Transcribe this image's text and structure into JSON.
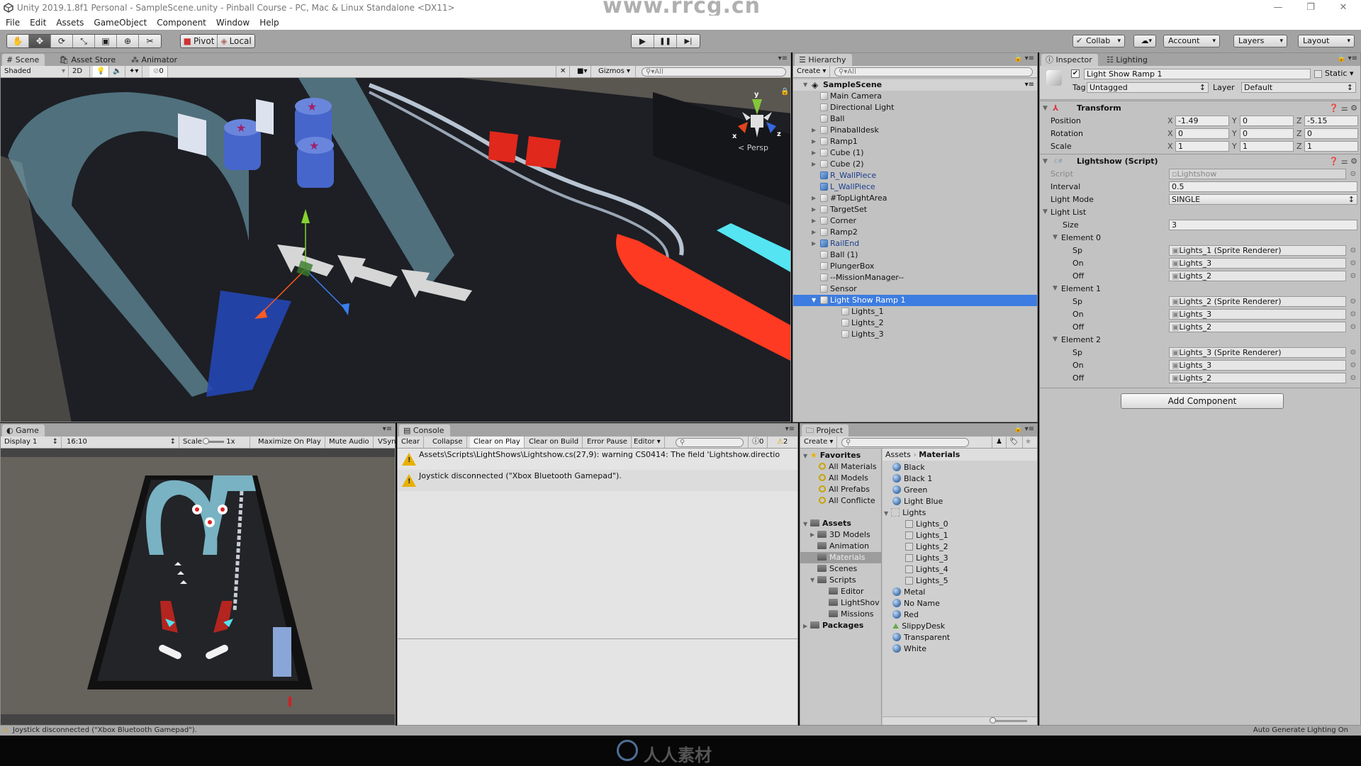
{
  "window": {
    "title": "Unity 2019.1.8f1 Personal - SampleScene.unity - Pinball Course - PC, Mac & Linux Standalone <DX11>",
    "controls": [
      "—",
      "❐",
      "✕"
    ]
  },
  "menu": [
    "File",
    "Edit",
    "Assets",
    "GameObject",
    "Component",
    "Window",
    "Help"
  ],
  "toolbar": {
    "tools": [
      {
        "icon": "hand-tool-icon",
        "glyph": "✋"
      },
      {
        "icon": "move-tool-icon",
        "glyph": "✥"
      },
      {
        "icon": "rotate-tool-icon",
        "glyph": "⟳"
      },
      {
        "icon": "scale-tool-icon",
        "glyph": "⤡"
      },
      {
        "icon": "rect-tool-icon",
        "glyph": "▣"
      },
      {
        "icon": "transform-tool-icon",
        "glyph": "⊕"
      },
      {
        "icon": "custom-tool-icon",
        "glyph": "✂"
      }
    ],
    "pivot": "Pivot",
    "local": "Local",
    "play": "▶",
    "pause": "❚❚",
    "step": "▶|",
    "collab": "Collab",
    "cloud": "☁",
    "account": "Account",
    "layers": "Layers",
    "layout": "Layout"
  },
  "scene": {
    "tabs": [
      "Scene",
      "Asset Store",
      "Animator"
    ],
    "shading": "Shaded",
    "mode2d": "2D",
    "hidden_count": "0",
    "gizmos": "Gizmos",
    "search_placeholder": "All",
    "projection": "Persp",
    "axes": {
      "x": "x",
      "y": "y",
      "z": "z"
    }
  },
  "hierarchy": {
    "title": "Hierarchy",
    "create": "Create",
    "search_placeholder": "All",
    "scene_name": "SampleScene",
    "items": [
      {
        "label": "Main Camera",
        "expand": false,
        "prefab": false,
        "indent": 1
      },
      {
        "label": "Directional Light",
        "expand": false,
        "prefab": false,
        "indent": 1
      },
      {
        "label": "Ball",
        "expand": false,
        "prefab": false,
        "indent": 1
      },
      {
        "label": "Pinaballdesk",
        "expand": true,
        "prefab": false,
        "indent": 1
      },
      {
        "label": "Ramp1",
        "expand": true,
        "prefab": false,
        "indent": 1
      },
      {
        "label": "Cube (1)",
        "expand": true,
        "prefab": false,
        "indent": 1
      },
      {
        "label": "Cube (2)",
        "expand": true,
        "prefab": false,
        "indent": 1
      },
      {
        "label": "R_WallPiece",
        "expand": false,
        "prefab": true,
        "indent": 1
      },
      {
        "label": "L_WallPiece",
        "expand": false,
        "prefab": true,
        "indent": 1
      },
      {
        "label": "#TopLightArea",
        "expand": true,
        "prefab": false,
        "indent": 1
      },
      {
        "label": "TargetSet",
        "expand": true,
        "prefab": false,
        "indent": 1
      },
      {
        "label": "Corner",
        "expand": true,
        "prefab": false,
        "indent": 1
      },
      {
        "label": "Ramp2",
        "expand": true,
        "prefab": false,
        "indent": 1
      },
      {
        "label": "RailEnd",
        "expand": true,
        "prefab": true,
        "indent": 1
      },
      {
        "label": "Ball (1)",
        "expand": false,
        "prefab": false,
        "indent": 1
      },
      {
        "label": "PlungerBox",
        "expand": false,
        "prefab": false,
        "indent": 1
      },
      {
        "label": "--MissionManager--",
        "expand": false,
        "prefab": false,
        "indent": 1
      },
      {
        "label": "Sensor",
        "expand": false,
        "prefab": false,
        "indent": 1
      },
      {
        "label": "Light Show Ramp 1",
        "expand": true,
        "expanded": true,
        "prefab": false,
        "indent": 1,
        "selected": true
      },
      {
        "label": "Lights_1",
        "expand": false,
        "prefab": false,
        "indent": 2
      },
      {
        "label": "Lights_2",
        "expand": false,
        "prefab": false,
        "indent": 2
      },
      {
        "label": "Lights_3",
        "expand": false,
        "prefab": false,
        "indent": 2
      }
    ]
  },
  "inspector": {
    "tabs": [
      "Inspector",
      "Lighting"
    ],
    "object_name": "Light Show Ramp 1",
    "active": true,
    "static_label": "Static",
    "tag_label": "Tag",
    "tag": "Untagged",
    "layer_label": "Layer",
    "layer": "Default",
    "transform": {
      "title": "Transform",
      "rows": [
        {
          "label": "Position",
          "x": "-1.49",
          "y": "0",
          "z": "-5.15"
        },
        {
          "label": "Rotation",
          "x": "0",
          "y": "0",
          "z": "0"
        },
        {
          "label": "Scale",
          "x": "1",
          "y": "1",
          "z": "1"
        }
      ]
    },
    "script": {
      "title": "Lightshow (Script)",
      "script_label": "Script",
      "script_value": "Lightshow",
      "interval_label": "Interval",
      "interval": "0.5",
      "mode_label": "Light Mode",
      "mode": "SINGLE",
      "list_label": "Light List",
      "size_label": "Size",
      "size": "3",
      "elements": [
        {
          "label": "Element 0",
          "sp": "Lights_1 (Sprite Renderer)",
          "on": "Lights_3",
          "off": "Lights_2"
        },
        {
          "label": "Element 1",
          "sp": "Lights_2 (Sprite Renderer)",
          "on": "Lights_3",
          "off": "Lights_2"
        },
        {
          "label": "Element 2",
          "sp": "Lights_3 (Sprite Renderer)",
          "on": "Lights_3",
          "off": "Lights_2"
        }
      ],
      "sp_label": "Sp",
      "on_label": "On",
      "off_label": "Off"
    },
    "add_component": "Add Component"
  },
  "game": {
    "tab": "Game",
    "display": "Display 1",
    "aspect": "16:10",
    "scale_label": "Scale",
    "scale_value": "1x",
    "maximize": "Maximize On Play",
    "mute": "Mute Audio",
    "vsync": "VSync"
  },
  "console": {
    "tab": "Console",
    "buttons": [
      "Clear",
      "Collapse",
      "Clear on Play",
      "Clear on Build",
      "Error Pause",
      "Editor"
    ],
    "error_count": "0",
    "warning_count": "2",
    "messages": [
      "Assets\\Scripts\\LightShows\\Lightshow.cs(27,9): warning CS0414: The field 'Lightshow.directio",
      "Joystick disconnected (\"Xbox Bluetooth Gamepad\")."
    ]
  },
  "project": {
    "tab": "Project",
    "create": "Create",
    "favorites_label": "Favorites",
    "favorites": [
      "All Materials",
      "All Models",
      "All Prefabs",
      "All Conflicte"
    ],
    "assets_label": "Assets",
    "folders": [
      {
        "label": "3D Models",
        "indent": 1,
        "expand": true
      },
      {
        "label": "Animation",
        "indent": 1
      },
      {
        "label": "Materials",
        "indent": 1,
        "selected": true
      },
      {
        "label": "Scenes",
        "indent": 1
      },
      {
        "label": "Scripts",
        "indent": 1,
        "expanded": true
      },
      {
        "label": "Editor",
        "indent": 2
      },
      {
        "label": "LightShov",
        "indent": 2
      },
      {
        "label": "Missions",
        "indent": 2
      }
    ],
    "packages_label": "Packages",
    "breadcrumb": [
      "Assets",
      "Materials"
    ],
    "files": [
      {
        "label": "Black",
        "type": "material",
        "indent": 0
      },
      {
        "label": "Black 1",
        "type": "material",
        "indent": 0
      },
      {
        "label": "Green",
        "type": "material",
        "indent": 0
      },
      {
        "label": "Light Blue",
        "type": "material",
        "indent": 0
      },
      {
        "label": "Lights",
        "type": "texture-group",
        "indent": 0
      },
      {
        "label": "Lights_0",
        "type": "sprite",
        "indent": 1
      },
      {
        "label": "Lights_1",
        "type": "sprite",
        "indent": 1
      },
      {
        "label": "Lights_2",
        "type": "sprite",
        "indent": 1
      },
      {
        "label": "Lights_3",
        "type": "sprite",
        "indent": 1
      },
      {
        "label": "Lights_4",
        "type": "sprite",
        "indent": 1
      },
      {
        "label": "Lights_5",
        "type": "sprite",
        "indent": 1
      },
      {
        "label": "Metal",
        "type": "material",
        "indent": 0
      },
      {
        "label": "No Name",
        "type": "material",
        "indent": 0
      },
      {
        "label": "Red",
        "type": "material",
        "indent": 0
      },
      {
        "label": "SlippyDesk",
        "type": "physic-material",
        "indent": 0
      },
      {
        "label": "Transparent",
        "type": "material",
        "indent": 0
      },
      {
        "label": "White",
        "type": "material",
        "indent": 0
      }
    ]
  },
  "status": {
    "message": "Joystick disconnected (\"Xbox Bluetooth Gamepad\").",
    "right": "Auto Generate Lighting On"
  },
  "watermark": {
    "site": "www.rrcg.cn",
    "logo_text": "人人素材"
  },
  "colors": {
    "selection": "#3d7ce0",
    "prefab_text": "#1b3e8e",
    "warning": "#e8b000"
  }
}
